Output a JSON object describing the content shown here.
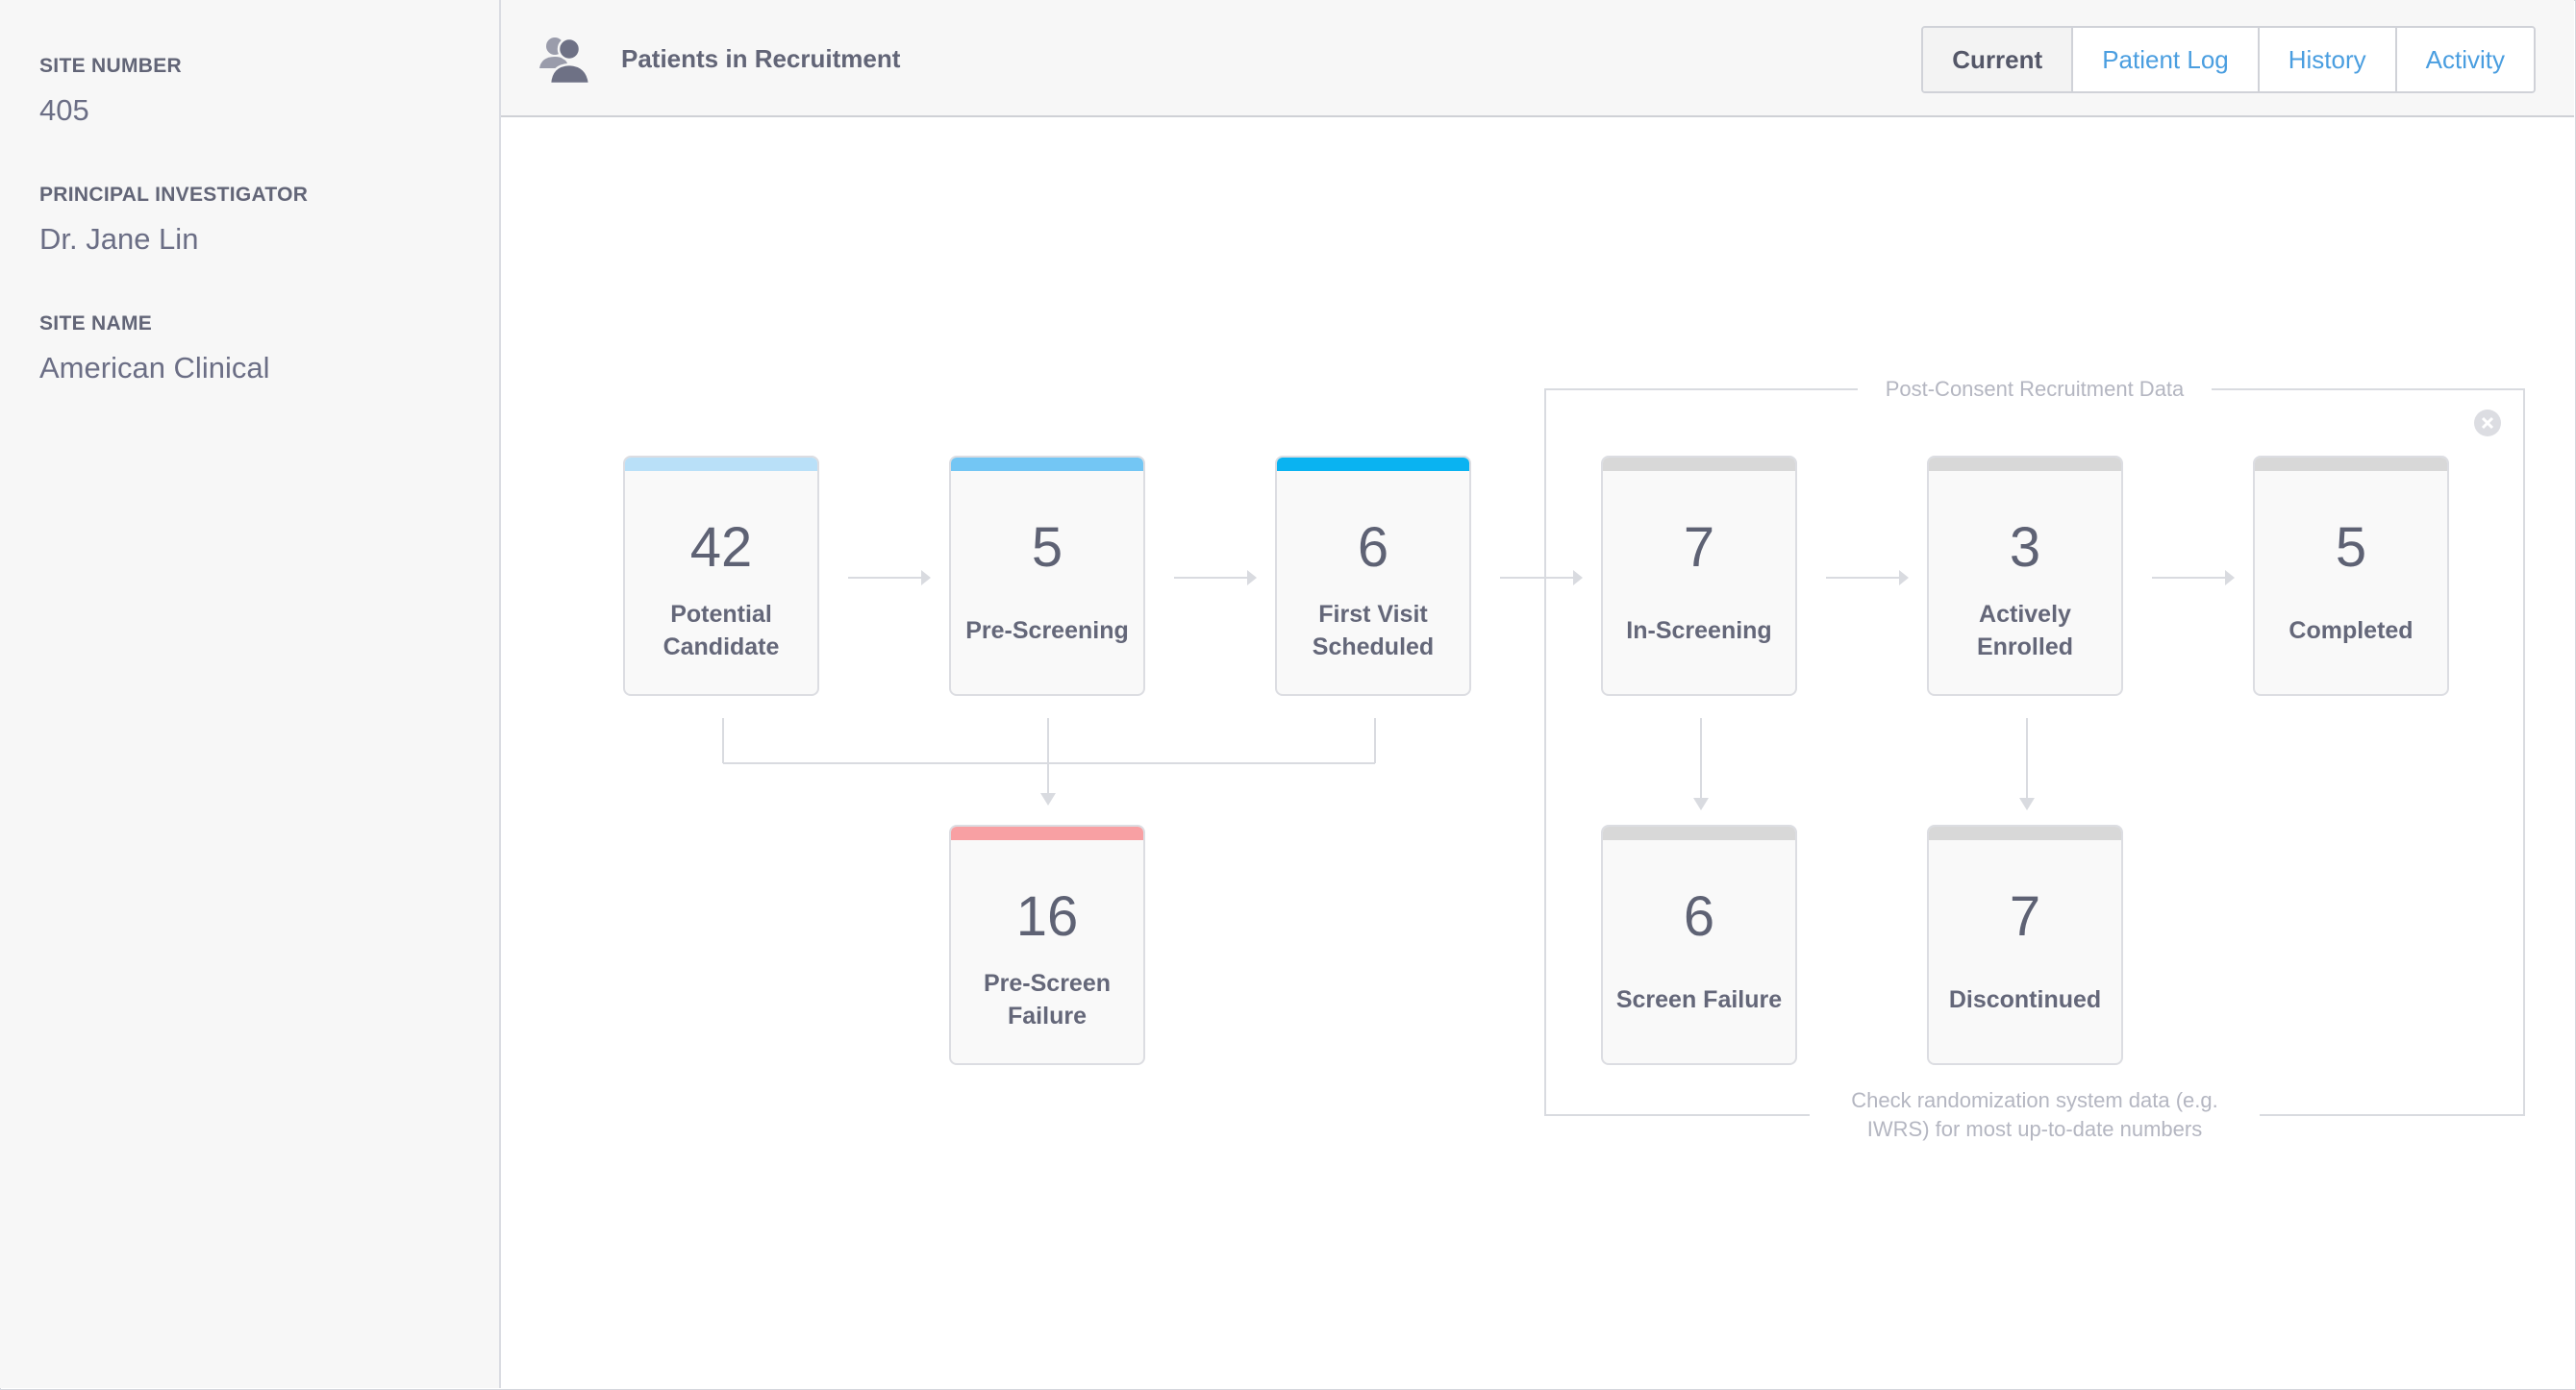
{
  "sidebar": {
    "site_number": {
      "label": "SITE NUMBER",
      "value": "405"
    },
    "principal_investigator": {
      "label": "PRINCIPAL INVESTIGATOR",
      "value": "Dr. Jane Lin"
    },
    "site_name": {
      "label": "SITE NAME",
      "value": "American Clinical"
    }
  },
  "header": {
    "icon": "patients-icon",
    "title": "Patients in Recruitment",
    "tabs": [
      {
        "label": "Current",
        "active": true
      },
      {
        "label": "Patient Log",
        "active": false
      },
      {
        "label": "History",
        "active": false
      },
      {
        "label": "Activity",
        "active": false
      }
    ]
  },
  "flow": {
    "potential_candidate": {
      "count": "42",
      "label_line1": "Potential",
      "label_line2": "Candidate",
      "color": "#b9e0f8"
    },
    "pre_screening": {
      "count": "5",
      "label_line1": "Pre-Screening",
      "label_line2": "",
      "color": "#73c6f4"
    },
    "first_visit": {
      "count": "6",
      "label_line1": "First Visit",
      "label_line2": "Scheduled",
      "color": "#0ab3f1"
    },
    "pre_screen_failure": {
      "count": "16",
      "label_line1": "Pre-Screen",
      "label_line2": "Failure",
      "color": "#f8a0a3"
    },
    "in_screening": {
      "count": "7",
      "label_line1": "In-Screening",
      "label_line2": "",
      "color": "#d8d8d8"
    },
    "actively_enrolled": {
      "count": "3",
      "label_line1": "Actively",
      "label_line2": "Enrolled",
      "color": "#d8d8d8"
    },
    "completed": {
      "count": "5",
      "label_line1": "Completed",
      "label_line2": "",
      "color": "#d8d8d8"
    },
    "screen_failure": {
      "count": "6",
      "label_line1": "Screen Failure",
      "label_line2": "",
      "color": "#d8d8d8"
    },
    "discontinued": {
      "count": "7",
      "label_line1": "Discontinued",
      "label_line2": "",
      "color": "#d8d8d8"
    }
  },
  "post_consent": {
    "title": "Post-Consent Recruitment Data",
    "close_icon": "close-icon",
    "footnote_line1": "Check randomization system data (e.g.",
    "footnote_line2": "IWRS) for most up-to-date numbers"
  }
}
